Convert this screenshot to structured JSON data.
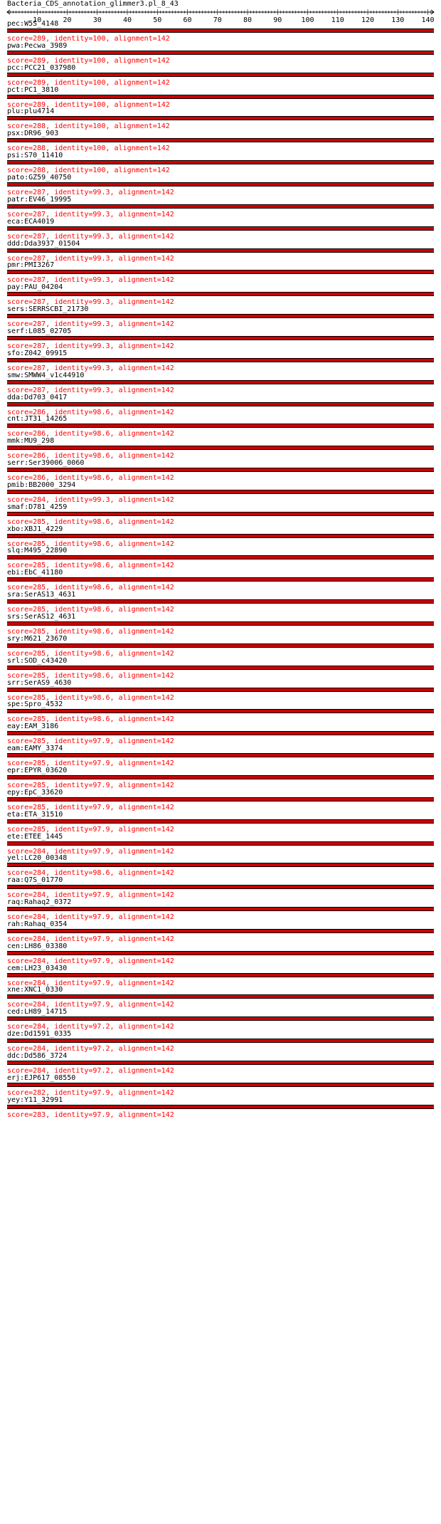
{
  "header": {
    "title": "Bacteria_CDS_annotation_glimmer3.pl_8_43"
  },
  "ruler": {
    "min": 0,
    "max": 142,
    "tick_labels": [
      "10",
      "20",
      "30",
      "40",
      "50",
      "60",
      "70",
      "80",
      "90",
      "100",
      "110",
      "120",
      "130",
      "140"
    ]
  },
  "colors": {
    "bar": "#cc0000",
    "bar_outline": "#000000",
    "stat_text": "#ff0000"
  },
  "hits": [
    {
      "name": "pec:W5S_4148",
      "stat": "score=289, identity=100, alignment=142"
    },
    {
      "name": "pwa:Pecwa_3989",
      "stat": "score=289, identity=100, alignment=142"
    },
    {
      "name": "pcc:PCC21_037980",
      "stat": "score=289, identity=100, alignment=142"
    },
    {
      "name": "pct:PC1_3810",
      "stat": "score=289, identity=100, alignment=142"
    },
    {
      "name": "plu:plu4714",
      "stat": "score=288, identity=100, alignment=142"
    },
    {
      "name": "psx:DR96_903",
      "stat": "score=288, identity=100, alignment=142"
    },
    {
      "name": "psi:S70_11410",
      "stat": "score=288, identity=100, alignment=142"
    },
    {
      "name": "pato:GZ59_40750",
      "stat": "score=287, identity=99.3, alignment=142"
    },
    {
      "name": "patr:EV46_19995",
      "stat": "score=287, identity=99.3, alignment=142"
    },
    {
      "name": "eca:ECA4019",
      "stat": "score=287, identity=99.3, alignment=142"
    },
    {
      "name": "ddd:Dda3937_01504",
      "stat": "score=287, identity=99.3, alignment=142"
    },
    {
      "name": "pmr:PMI3267",
      "stat": "score=287, identity=99.3, alignment=142"
    },
    {
      "name": "pay:PAU_04204",
      "stat": "score=287, identity=99.3, alignment=142"
    },
    {
      "name": "sers:SERRSCBI_21730",
      "stat": "score=287, identity=99.3, alignment=142"
    },
    {
      "name": "serf:L085_02705",
      "stat": "score=287, identity=99.3, alignment=142"
    },
    {
      "name": "sfo:Z042_09915",
      "stat": "score=287, identity=99.3, alignment=142"
    },
    {
      "name": "smw:SMWW4_v1c44910",
      "stat": "score=287, identity=99.3, alignment=142"
    },
    {
      "name": "dda:Dd703_0417",
      "stat": "score=286, identity=98.6, alignment=142"
    },
    {
      "name": "cnt:JT31_14265",
      "stat": "score=286, identity=98.6, alignment=142"
    },
    {
      "name": "mmk:MU9_298",
      "stat": "score=286, identity=98.6, alignment=142"
    },
    {
      "name": "serr:Ser39006_0060",
      "stat": "score=286, identity=98.6, alignment=142"
    },
    {
      "name": "pmib:BB2000_3294",
      "stat": "score=284, identity=99.3, alignment=142"
    },
    {
      "name": "smaf:D781_4259",
      "stat": "score=285, identity=98.6, alignment=142"
    },
    {
      "name": "xbo:XBJ1_4229",
      "stat": "score=285, identity=98.6, alignment=142"
    },
    {
      "name": "slq:M495_22890",
      "stat": "score=285, identity=98.6, alignment=142"
    },
    {
      "name": "ebi:EbC_41180",
      "stat": "score=285, identity=98.6, alignment=142"
    },
    {
      "name": "sra:SerAS13_4631",
      "stat": "score=285, identity=98.6, alignment=142"
    },
    {
      "name": "srs:SerAS12_4631",
      "stat": "score=285, identity=98.6, alignment=142"
    },
    {
      "name": "sry:M621_23670",
      "stat": "score=285, identity=98.6, alignment=142"
    },
    {
      "name": "srl:SOD_c43420",
      "stat": "score=285, identity=98.6, alignment=142"
    },
    {
      "name": "srr:SerAS9_4630",
      "stat": "score=285, identity=98.6, alignment=142"
    },
    {
      "name": "spe:Spro_4532",
      "stat": "score=285, identity=98.6, alignment=142"
    },
    {
      "name": "eay:EAM_3186",
      "stat": "score=285, identity=97.9, alignment=142"
    },
    {
      "name": "eam:EAMY_3374",
      "stat": "score=285, identity=97.9, alignment=142"
    },
    {
      "name": "epr:EPYR_03620",
      "stat": "score=285, identity=97.9, alignment=142"
    },
    {
      "name": "epy:EpC_33620",
      "stat": "score=285, identity=97.9, alignment=142"
    },
    {
      "name": "eta:ETA_31510",
      "stat": "score=285, identity=97.9, alignment=142"
    },
    {
      "name": "ete:ETEE_1445",
      "stat": "score=284, identity=97.9, alignment=142"
    },
    {
      "name": "yel:LC20_00348",
      "stat": "score=284, identity=98.6, alignment=142"
    },
    {
      "name": "raa:Q7S_01770",
      "stat": "score=284, identity=97.9, alignment=142"
    },
    {
      "name": "raq:Rahaq2_0372",
      "stat": "score=284, identity=97.9, alignment=142"
    },
    {
      "name": "rah:Rahaq_0354",
      "stat": "score=284, identity=97.9, alignment=142"
    },
    {
      "name": "cen:LH86_03380",
      "stat": "score=284, identity=97.9, alignment=142"
    },
    {
      "name": "cem:LH23_03430",
      "stat": "score=284, identity=97.9, alignment=142"
    },
    {
      "name": "xne:XNC1_0330",
      "stat": "score=284, identity=97.9, alignment=142"
    },
    {
      "name": "ced:LH89_14715",
      "stat": "score=284, identity=97.2, alignment=142"
    },
    {
      "name": "dze:Dd1591_0335",
      "stat": "score=284, identity=97.2, alignment=142"
    },
    {
      "name": "ddc:Dd586_3724",
      "stat": "score=284, identity=97.2, alignment=142"
    },
    {
      "name": "erj:EJP617_08550",
      "stat": "score=282, identity=97.9, alignment=142"
    },
    {
      "name": "yey:Y11_32991",
      "stat": "score=283, identity=97.9, alignment=142"
    }
  ]
}
